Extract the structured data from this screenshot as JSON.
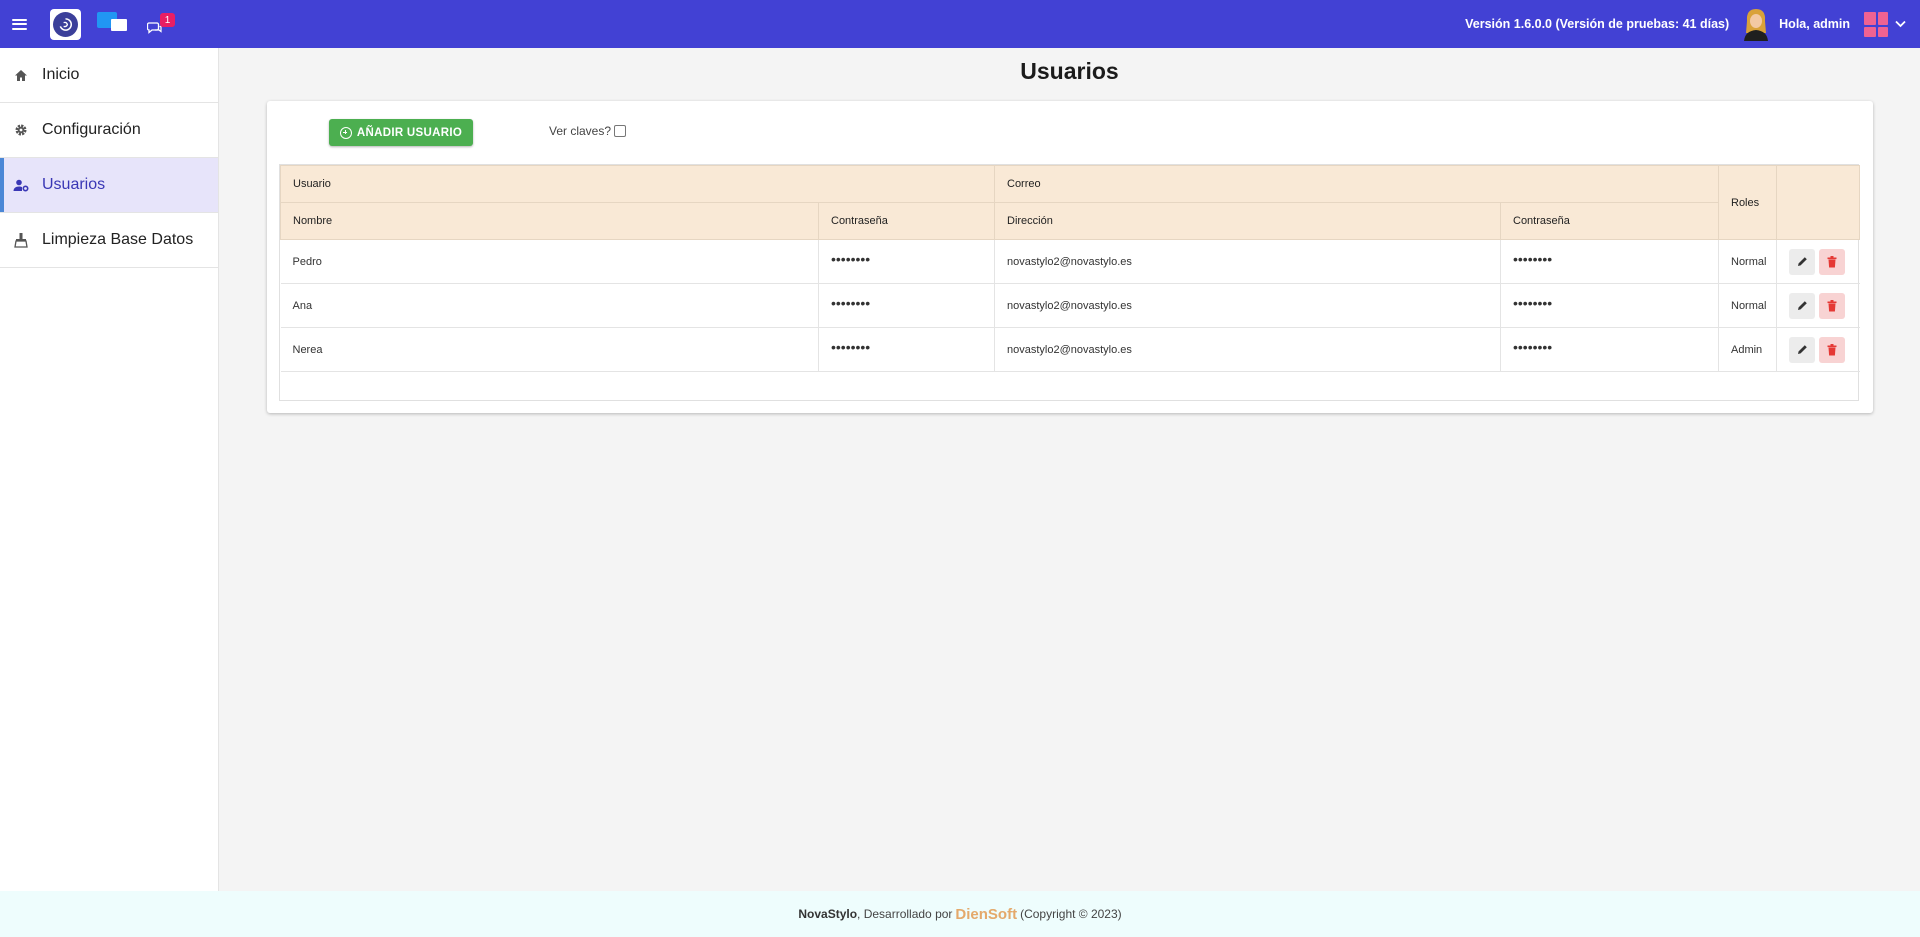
{
  "header": {
    "version_text": "Versión 1.6.0.0 (Versión de pruebas: 41 días)",
    "greeting": "Hola, admin",
    "chat_badge_count": "1",
    "accent_color": "#4241d4"
  },
  "sidebar": {
    "items": [
      {
        "label": "Inicio",
        "icon": "home-icon"
      },
      {
        "label": "Configuración",
        "icon": "gear-icon"
      },
      {
        "label": "Usuarios",
        "icon": "users-settings-icon",
        "active": true
      },
      {
        "label": "Limpieza Base Datos",
        "icon": "broom-icon"
      }
    ]
  },
  "main": {
    "title": "Usuarios",
    "add_button_label": "AÑADIR USUARIO",
    "show_passwords_label": "Ver claves?",
    "show_passwords_checked": false
  },
  "table": {
    "group_headers": {
      "usuario": "Usuario",
      "correo": "Correo",
      "roles": "Roles"
    },
    "sub_headers": {
      "nombre": "Nombre",
      "contrasena": "Contraseña",
      "direccion": "Dirección",
      "contrasena2": "Contraseña"
    },
    "rows": [
      {
        "nombre": "Pedro",
        "contrasena": "••••••••",
        "direccion": "novastylo2@novastylo.es",
        "contrasena2": "••••••••",
        "rol": "Normal"
      },
      {
        "nombre": "Ana",
        "contrasena": "••••••••",
        "direccion": "novastylo2@novastylo.es",
        "contrasena2": "••••••••",
        "rol": "Normal"
      },
      {
        "nombre": "Nerea",
        "contrasena": "••••••••",
        "direccion": "novastylo2@novastylo.es",
        "contrasena2": "••••••••",
        "rol": "Admin"
      }
    ]
  },
  "footer": {
    "app_name": "NovaStylo",
    "developed_by": ", Desarrollado por",
    "company": "DienSoft",
    "copyright": "(Copyright © 2023)"
  }
}
